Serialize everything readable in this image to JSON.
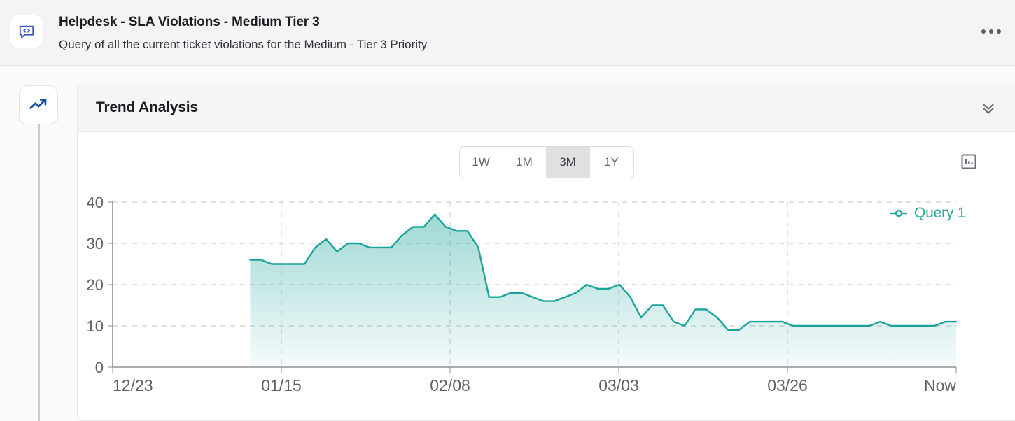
{
  "header": {
    "icon": "code-speech-bubble-icon",
    "title": "Helpdesk - SLA Violations - Medium Tier 3",
    "subtitle": "Query of all the current ticket violations for the Medium - Tier 3 Priority",
    "menu_icon": "more-options-icon"
  },
  "rail": {
    "icon": "trending-up-icon"
  },
  "card": {
    "title": "Trend Analysis",
    "collapse_icon": "double-chevron-down-icon"
  },
  "range_selector": {
    "options": [
      {
        "label": "1W",
        "active": false
      },
      {
        "label": "1M",
        "active": false
      },
      {
        "label": "3M",
        "active": true
      },
      {
        "label": "1Y",
        "active": false
      }
    ],
    "selected": "3M"
  },
  "chart_type_toggle": {
    "icon": "bar-chart-icon"
  },
  "colors": {
    "line": "#1aa39a",
    "legend_text": "#23a89e",
    "accent_blue": "#2b5fd9",
    "rail_icon": "#15519e",
    "grid": "#cfcfcf",
    "axis_text": "#5f6368"
  },
  "chart_data": {
    "type": "area",
    "title": "Trend Analysis",
    "xlabel": "",
    "ylabel": "",
    "ylim": [
      0,
      40
    ],
    "yticks": [
      0,
      10,
      20,
      30,
      40
    ],
    "xticks": [
      "12/23",
      "01/15",
      "02/08",
      "03/03",
      "03/26",
      "Now"
    ],
    "grid": true,
    "legend_position": "right",
    "series": [
      {
        "name": "Query 1",
        "color": "#1aa39a",
        "x_start_fraction": 0.163,
        "values": [
          26,
          26,
          25,
          25,
          25,
          25,
          29,
          31,
          28,
          30,
          30,
          29,
          29,
          29,
          32,
          34,
          34,
          37,
          34,
          33,
          33,
          29,
          17,
          17,
          18,
          18,
          17,
          16,
          16,
          17,
          18,
          20,
          19,
          19,
          20,
          17,
          12,
          15,
          15,
          11,
          10,
          14,
          14,
          12,
          9,
          9,
          11,
          11,
          11,
          11,
          10,
          10,
          10,
          10,
          10,
          10,
          10,
          10,
          11,
          10,
          10,
          10,
          10,
          10,
          11,
          11
        ]
      }
    ]
  }
}
